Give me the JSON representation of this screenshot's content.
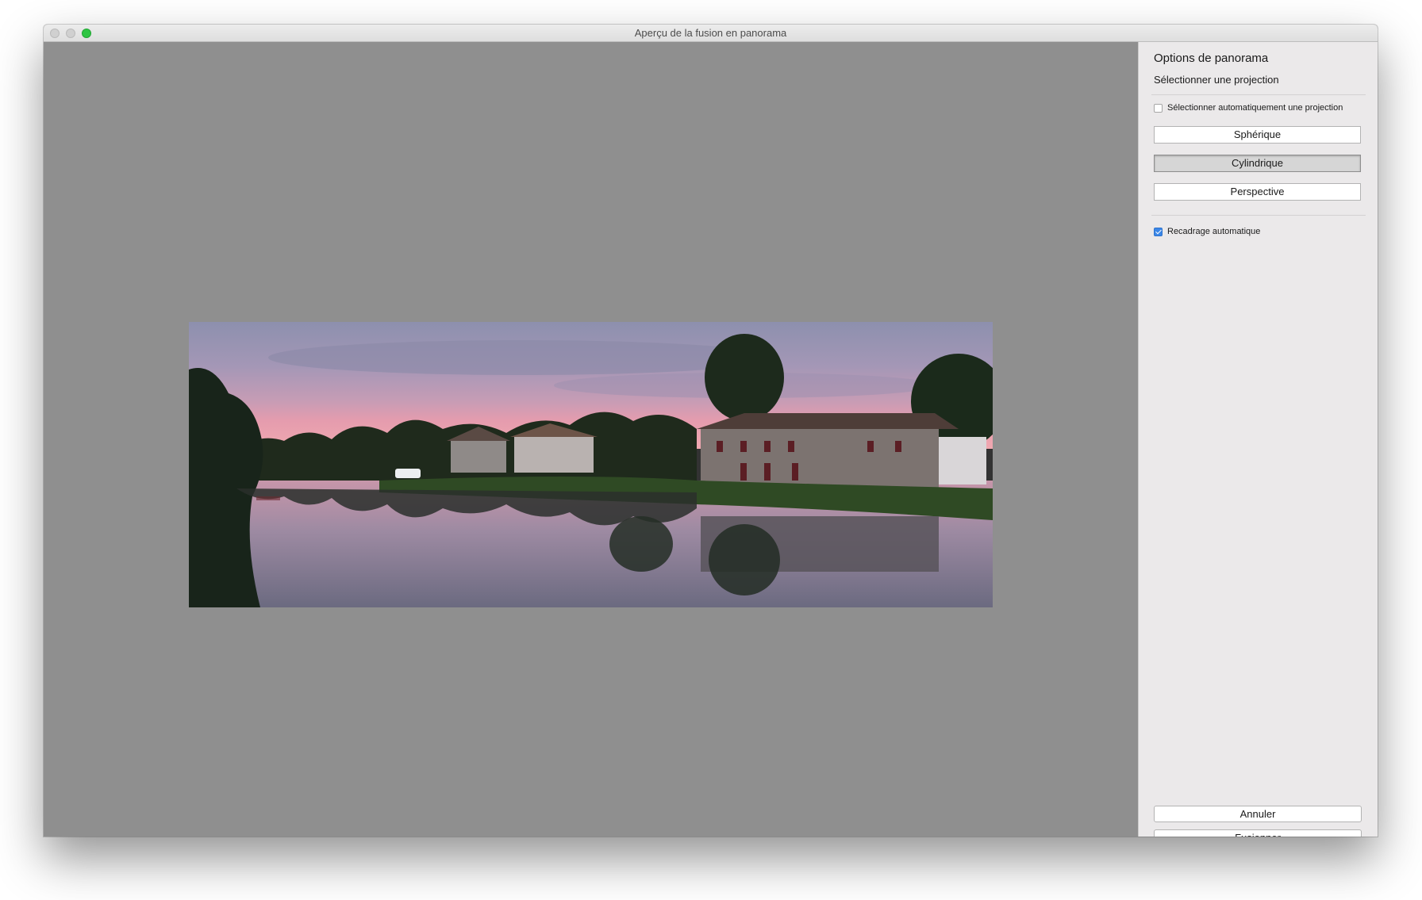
{
  "window": {
    "title": "Aperçu de la fusion en panorama"
  },
  "sidebar": {
    "title": "Options de panorama",
    "subtitle": "Sélectionner une projection",
    "auto_select": {
      "label": "Sélectionner automatiquement une projection",
      "checked": false
    },
    "projections": [
      {
        "label": "Sphérique",
        "selected": false
      },
      {
        "label": "Cylindrique",
        "selected": true
      },
      {
        "label": "Perspective",
        "selected": false
      }
    ],
    "auto_crop": {
      "label": "Recadrage automatique",
      "checked": true
    },
    "cancel_label": "Annuler",
    "merge_label": "Fusionner"
  },
  "colors": {
    "preview_background": "#8f8f8f",
    "sidebar_background": "#ebe9ea",
    "checkbox_accent": "#3b87e8",
    "zoom_button": "#2ec543"
  },
  "icons": {
    "close": "close-icon",
    "minimize": "minimize-icon",
    "zoom": "zoom-icon"
  }
}
